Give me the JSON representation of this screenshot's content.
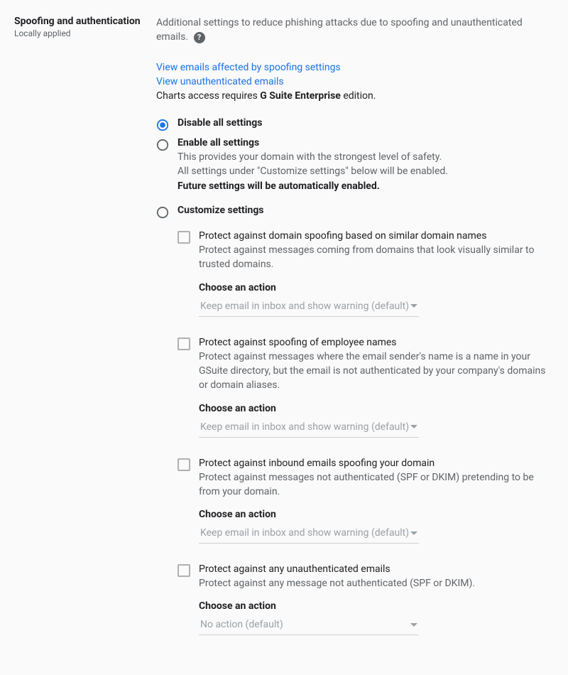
{
  "section": {
    "title": "Spoofing and authentication",
    "scope": "Locally applied"
  },
  "description": "Additional settings to reduce phishing attacks due to spoofing and unauthenticated emails.",
  "help_glyph": "?",
  "links": {
    "spoofing": "View emails affected by spoofing settings",
    "unauth": "View unauthenticated emails",
    "charts_note_prefix": "Charts access requires ",
    "charts_note_bold": "G Suite Enterprise",
    "charts_note_suffix": " edition."
  },
  "radios": {
    "disable": "Disable all settings",
    "enable": {
      "label": "Enable all settings",
      "line1": "This provides your domain with the strongest level of safety.",
      "line2": "All settings under \"Customize settings\" below will be enabled.",
      "line3": "Future settings will be automatically enabled."
    },
    "customize": "Customize settings"
  },
  "action_label": "Choose an action",
  "default_warning": "Keep email in inbox and show warning (default)",
  "default_none": "No action (default)",
  "items": [
    {
      "title": "Protect against domain spoofing based on similar domain names",
      "desc": "Protect against messages coming from domains that look visually similar to trusted domains.",
      "selected": "default_warning"
    },
    {
      "title": "Protect against spoofing of employee names",
      "desc": "Protect against messages where the email sender's name is a name in your GSuite directory, but the email is not authenticated by your company's domains or domain aliases.",
      "selected": "default_warning"
    },
    {
      "title": "Protect against inbound emails spoofing your domain",
      "desc": "Protect against messages not authenticated (SPF or DKIM) pretending to be from your domain.",
      "selected": "default_warning"
    },
    {
      "title": "Protect against any unauthenticated emails",
      "desc": "Protect against any message not authenticated (SPF or DKIM).",
      "selected": "default_none"
    }
  ]
}
